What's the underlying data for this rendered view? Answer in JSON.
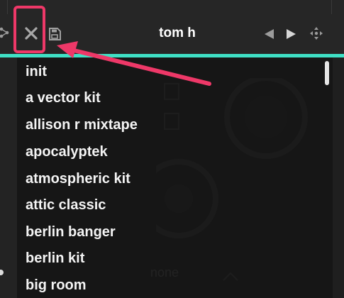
{
  "header": {
    "title": "tom h"
  },
  "icons": {
    "share": "share-icon",
    "close": "close-icon",
    "save": "save-icon",
    "prev": "prev-arrow-icon",
    "next": "next-arrow-icon",
    "random": "randomize-icon"
  },
  "accent_color": "#3fe0c5",
  "annotation_color": "#ee3868",
  "preset_list": {
    "items": [
      {
        "label": "init"
      },
      {
        "label": "a vector kit"
      },
      {
        "label": "allison r mixtape"
      },
      {
        "label": "apocalyptek"
      },
      {
        "label": "atmospheric kit"
      },
      {
        "label": "attic classic"
      },
      {
        "label": "berlin banger"
      },
      {
        "label": "berlin kit"
      },
      {
        "label": "big room"
      }
    ]
  },
  "background": {
    "footer_label": "none"
  }
}
